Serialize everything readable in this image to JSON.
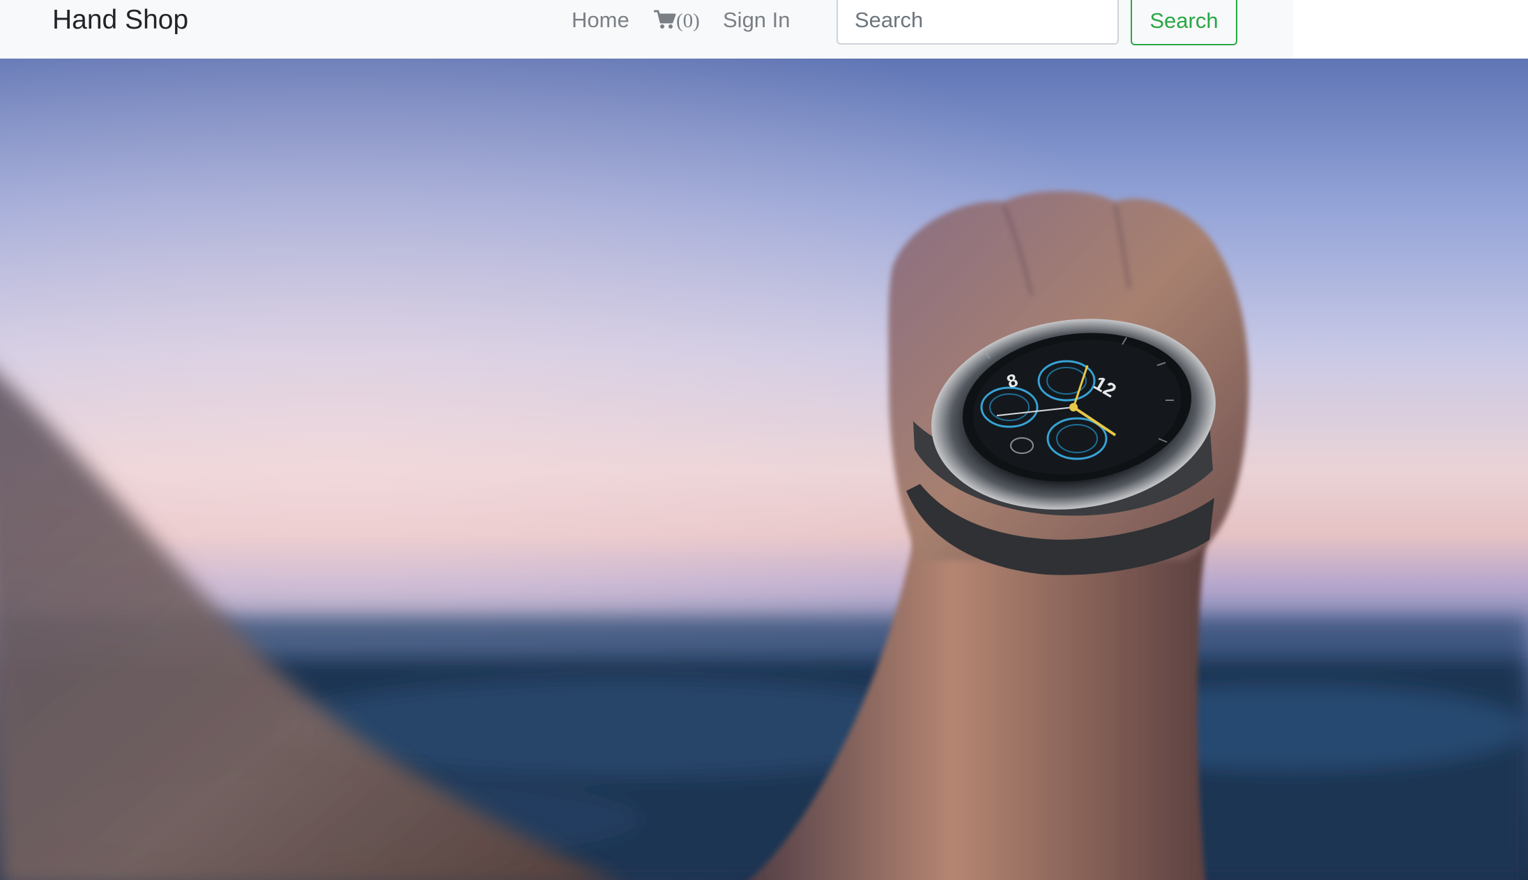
{
  "navbar": {
    "brand": "Hand Shop",
    "links": {
      "home": "Home",
      "cart_count": "(0)",
      "sign_in": "Sign In"
    },
    "search": {
      "placeholder": "Search",
      "value": "",
      "button_label": "Search"
    }
  },
  "hero": {
    "image_subject": "hand wearing a smartwatch against a dusk sky over the sea",
    "watch_dial_numbers": [
      "8",
      "12"
    ]
  },
  "colors": {
    "navbar_bg": "#f8f9fa",
    "brand_text": "#212529",
    "nav_link": "#7a7f85",
    "search_accent": "#28a745",
    "input_border": "#ced4da"
  },
  "icons": {
    "cart": "shopping-cart-icon"
  }
}
